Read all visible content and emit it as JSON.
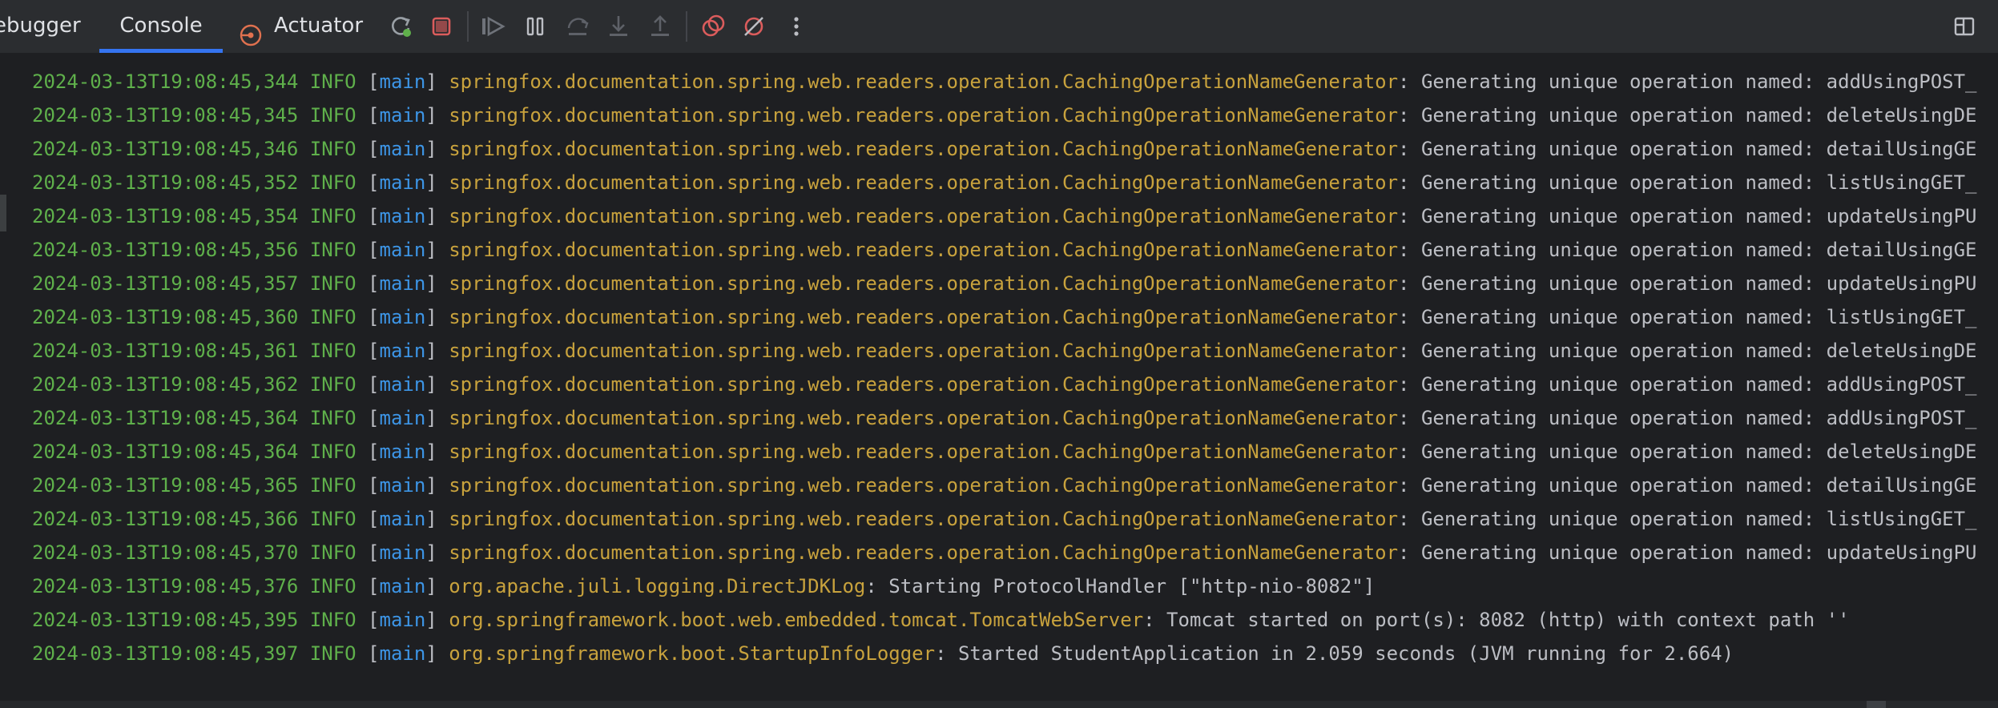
{
  "toolbar": {
    "tabs": {
      "debugger": "ebugger",
      "console": "Console",
      "actuator": "Actuator"
    },
    "icons": [
      "rerun-icon",
      "stop-icon",
      "resume-icon",
      "pause-icon",
      "step-over-icon",
      "step-into-icon",
      "step-out-icon",
      "view-breakpoints-icon",
      "mute-breakpoints-icon",
      "more-options-icon",
      "layout-icon"
    ]
  },
  "console": {
    "lines": [
      {
        "ts": "2024-03-13T19:08:45,344",
        "level": "INFO",
        "thread": "main",
        "logger": "springfox.documentation.spring.web.readers.operation.CachingOperationNameGenerator",
        "message": ": Generating unique operation named: addUsingPOST_"
      },
      {
        "ts": "2024-03-13T19:08:45,345",
        "level": "INFO",
        "thread": "main",
        "logger": "springfox.documentation.spring.web.readers.operation.CachingOperationNameGenerator",
        "message": ": Generating unique operation named: deleteUsingDE"
      },
      {
        "ts": "2024-03-13T19:08:45,346",
        "level": "INFO",
        "thread": "main",
        "logger": "springfox.documentation.spring.web.readers.operation.CachingOperationNameGenerator",
        "message": ": Generating unique operation named: detailUsingGE"
      },
      {
        "ts": "2024-03-13T19:08:45,352",
        "level": "INFO",
        "thread": "main",
        "logger": "springfox.documentation.spring.web.readers.operation.CachingOperationNameGenerator",
        "message": ": Generating unique operation named: listUsingGET_"
      },
      {
        "ts": "2024-03-13T19:08:45,354",
        "level": "INFO",
        "thread": "main",
        "logger": "springfox.documentation.spring.web.readers.operation.CachingOperationNameGenerator",
        "message": ": Generating unique operation named: updateUsingPU"
      },
      {
        "ts": "2024-03-13T19:08:45,356",
        "level": "INFO",
        "thread": "main",
        "logger": "springfox.documentation.spring.web.readers.operation.CachingOperationNameGenerator",
        "message": ": Generating unique operation named: detailUsingGE"
      },
      {
        "ts": "2024-03-13T19:08:45,357",
        "level": "INFO",
        "thread": "main",
        "logger": "springfox.documentation.spring.web.readers.operation.CachingOperationNameGenerator",
        "message": ": Generating unique operation named: updateUsingPU"
      },
      {
        "ts": "2024-03-13T19:08:45,360",
        "level": "INFO",
        "thread": "main",
        "logger": "springfox.documentation.spring.web.readers.operation.CachingOperationNameGenerator",
        "message": ": Generating unique operation named: listUsingGET_"
      },
      {
        "ts": "2024-03-13T19:08:45,361",
        "level": "INFO",
        "thread": "main",
        "logger": "springfox.documentation.spring.web.readers.operation.CachingOperationNameGenerator",
        "message": ": Generating unique operation named: deleteUsingDE"
      },
      {
        "ts": "2024-03-13T19:08:45,362",
        "level": "INFO",
        "thread": "main",
        "logger": "springfox.documentation.spring.web.readers.operation.CachingOperationNameGenerator",
        "message": ": Generating unique operation named: addUsingPOST_"
      },
      {
        "ts": "2024-03-13T19:08:45,364",
        "level": "INFO",
        "thread": "main",
        "logger": "springfox.documentation.spring.web.readers.operation.CachingOperationNameGenerator",
        "message": ": Generating unique operation named: addUsingPOST_"
      },
      {
        "ts": "2024-03-13T19:08:45,364",
        "level": "INFO",
        "thread": "main",
        "logger": "springfox.documentation.spring.web.readers.operation.CachingOperationNameGenerator",
        "message": ": Generating unique operation named: deleteUsingDE"
      },
      {
        "ts": "2024-03-13T19:08:45,365",
        "level": "INFO",
        "thread": "main",
        "logger": "springfox.documentation.spring.web.readers.operation.CachingOperationNameGenerator",
        "message": ": Generating unique operation named: detailUsingGE"
      },
      {
        "ts": "2024-03-13T19:08:45,366",
        "level": "INFO",
        "thread": "main",
        "logger": "springfox.documentation.spring.web.readers.operation.CachingOperationNameGenerator",
        "message": ": Generating unique operation named: listUsingGET_"
      },
      {
        "ts": "2024-03-13T19:08:45,370",
        "level": "INFO",
        "thread": "main",
        "logger": "springfox.documentation.spring.web.readers.operation.CachingOperationNameGenerator",
        "message": ": Generating unique operation named: updateUsingPU"
      },
      {
        "ts": "2024-03-13T19:08:45,376",
        "level": "INFO",
        "thread": "main",
        "logger": "org.apache.juli.logging.DirectJDKLog",
        "message": ": Starting ProtocolHandler [\"http-nio-8082\"]"
      },
      {
        "ts": "2024-03-13T19:08:45,395",
        "level": "INFO",
        "thread": "main",
        "logger": "org.springframework.boot.web.embedded.tomcat.TomcatWebServer",
        "message": ": Tomcat started on port(s): 8082 (http) with context path ''"
      },
      {
        "ts": "2024-03-13T19:08:45,397",
        "level": "INFO",
        "thread": "main",
        "logger": "org.springframework.boot.StartupInfoLogger",
        "message": ": Started StudentApplication in 2.059 seconds (JVM running for 2.664)"
      }
    ]
  },
  "colors": {
    "background": "#1e1f22",
    "toolbar": "#2b2d30",
    "timestamp": "#5fb04b",
    "thread": "#3d95e6",
    "logger": "#c8a23d",
    "message": "#bcbec4",
    "accent": "#3574f0"
  }
}
